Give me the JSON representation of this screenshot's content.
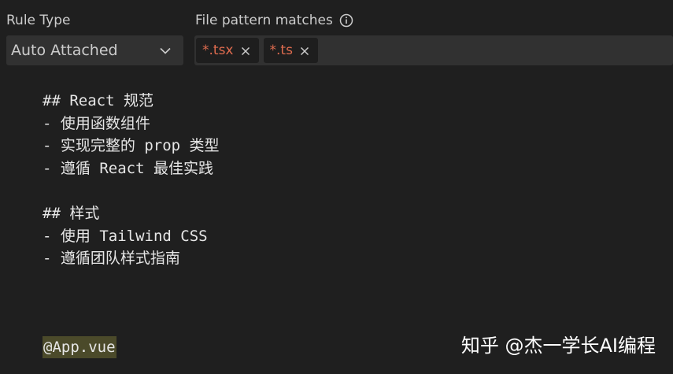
{
  "rule_type": {
    "label": "Rule Type",
    "value": "Auto Attached"
  },
  "file_pattern": {
    "label": "File pattern matches",
    "chips": [
      {
        "text": "*.tsx"
      },
      {
        "text": "*.ts"
      }
    ]
  },
  "editor": {
    "lines": [
      "## React 规范",
      "- 使用函数组件",
      "- 实现完整的 prop 类型",
      "- 遵循 React 最佳实践",
      "",
      "## 样式",
      "- 使用 Tailwind CSS",
      "- 遵循团队样式指南"
    ],
    "mention": "@App.vue"
  },
  "watermark": "知乎 @杰一学长AI编程",
  "colors": {
    "background": "#1f1f1f",
    "field": "#313131",
    "chip": "#1e1e1e",
    "chip_text": "#e06c4f",
    "mention_highlight": "#4b4a2a"
  },
  "icons": [
    "info-icon",
    "chevron-down-icon",
    "close-icon"
  ]
}
